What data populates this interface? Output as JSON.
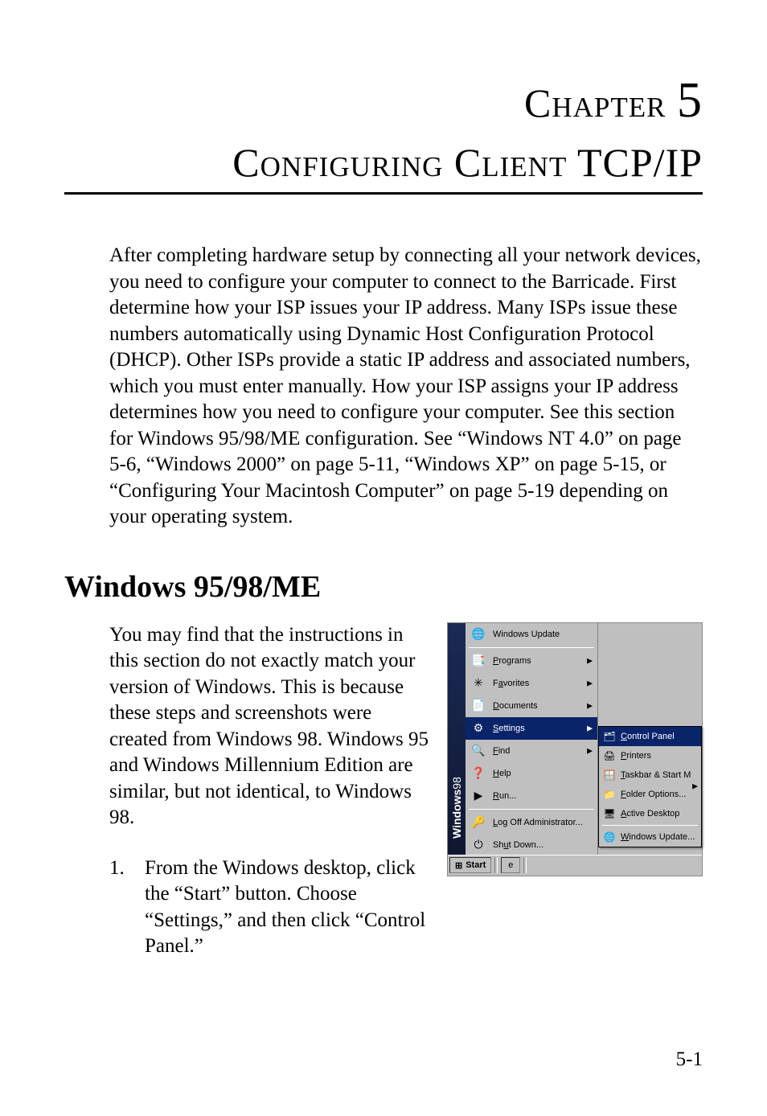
{
  "chapter": {
    "label_prefix": "Chapter",
    "number": "5",
    "title": "Configuring Client TCP/IP"
  },
  "intro_paragraph": "After completing hardware setup by connecting all your network devices, you need to configure your computer to connect to the Barricade. First determine how your ISP issues your IP address. Many ISPs issue these numbers automatically using Dynamic Host Configuration Protocol (DHCP). Other ISPs provide a static IP address and associated numbers, which you must enter manually. How your ISP assigns your IP address determines how you need to configure your computer. See this section for Windows 95/98/ME configuration. See “Windows NT 4.0” on page 5-6, “Windows 2000” on page 5-11, “Windows XP” on page 5-15, or “Configuring Your Macintosh Computer” on page 5-19 depending on your operating system.",
  "section_heading": "Windows 95/98/ME",
  "body_paragraph": "You may find that the instructions in this section do not exactly match your version of Windows. This is because these steps and screenshots were created from Windows 98. Windows 95 and Windows Millennium Edition are similar, but not identical, to Windows 98.",
  "list": {
    "marker": "1.",
    "text": "From the Windows desktop, click the “Start” button. Choose “Settings,” and then click “Control Panel.”"
  },
  "start_menu": {
    "brand": "Windows",
    "brand_suffix": "98",
    "items": [
      {
        "label": "Windows Update",
        "icon": "globe-icon",
        "submenu": false
      },
      {
        "label": "Programs",
        "icon": "programs-icon",
        "submenu": true,
        "underline_char": "P"
      },
      {
        "label": "Favorites",
        "icon": "favorites-icon",
        "submenu": true,
        "underline_char": "a"
      },
      {
        "label": "Documents",
        "icon": "documents-icon",
        "submenu": true,
        "underline_char": "D"
      },
      {
        "label": "Settings",
        "icon": "settings-icon",
        "submenu": true,
        "selected": true,
        "underline_char": "S"
      },
      {
        "label": "Find",
        "icon": "find-icon",
        "submenu": true,
        "underline_char": "F"
      },
      {
        "label": "Help",
        "icon": "help-icon",
        "submenu": false,
        "underline_char": "H"
      },
      {
        "label": "Run...",
        "icon": "run-icon",
        "submenu": false,
        "underline_char": "R"
      },
      {
        "label": "Log Off Administrator...",
        "icon": "logoff-icon",
        "submenu": false,
        "underline_char": "L"
      },
      {
        "label": "Shut Down...",
        "icon": "shutdown-icon",
        "submenu": false,
        "underline_char": "u"
      }
    ],
    "settings_submenu": [
      {
        "label": "Control Panel",
        "icon": "control-panel-icon",
        "selected": true,
        "underline_char": "C"
      },
      {
        "label": "Printers",
        "icon": "printers-icon",
        "underline_char": "P"
      },
      {
        "label": "Taskbar & Start M",
        "icon": "taskbar-icon",
        "underline_char": "T"
      },
      {
        "label": "Folder Options...",
        "icon": "folder-options-icon",
        "underline_char": "F"
      },
      {
        "label": "Active Desktop",
        "icon": "active-desktop-icon",
        "submenu": true,
        "underline_char": "A"
      },
      {
        "label": "Windows Update...",
        "icon": "windows-update-icon",
        "underline_char": "W"
      }
    ],
    "taskbar": {
      "start_label": "Start"
    }
  },
  "page_number": "5-1"
}
